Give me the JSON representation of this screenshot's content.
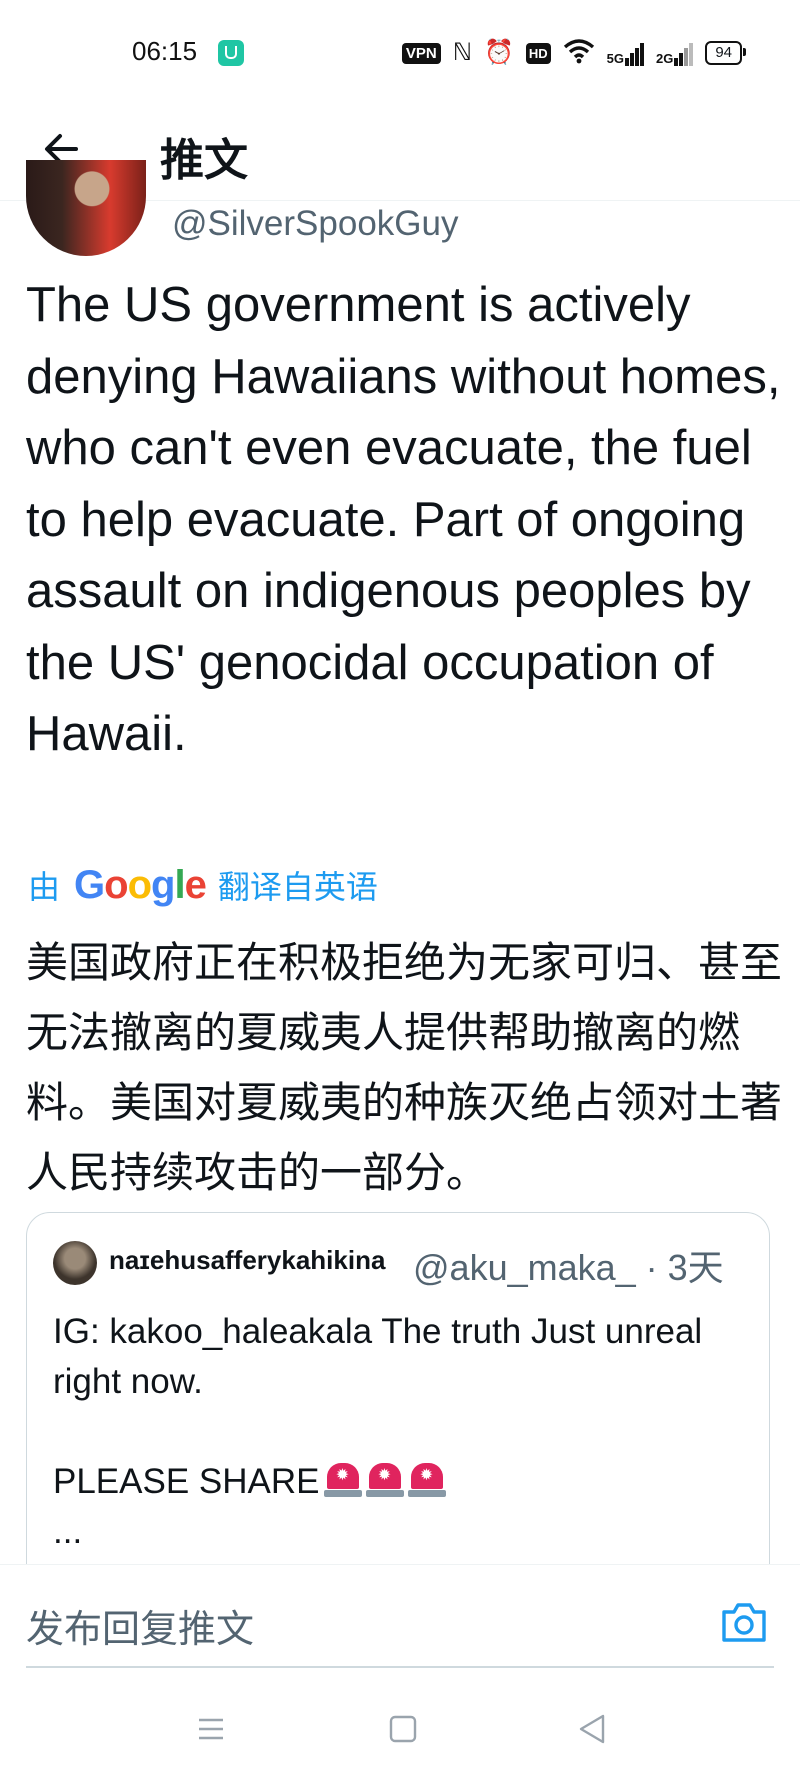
{
  "status_bar": {
    "time": "06:15",
    "vpn_label": "VPN",
    "nfc_icon": "nfc-icon",
    "alarm_icon": "alarm-icon",
    "hd_label": "HD",
    "signal1_label": "5G",
    "signal2_label": "2G",
    "battery": "94"
  },
  "header": {
    "title": "推文",
    "back_icon": "back-arrow-icon"
  },
  "tweet": {
    "handle": "@SilverSpookGuy",
    "text": "The US government is actively denying Hawaiians without homes, who can't even evacuate, the fuel to help evacuate. Part of ongoing assault on indigenous peoples by the US' genocidal occupation of Hawaii.",
    "translate_prefix": "由",
    "translate_brand": "Google",
    "translate_suffix": "翻译自英语",
    "translated_text": "美国政府正在积极拒绝为无家可归、甚至无法撤离的夏威夷人提供帮助撤离的燃料。美国对夏威夷的种族灭绝占领对土著人民持续攻击的一部分。"
  },
  "quote": {
    "name": "naɪehusafferykahikina",
    "meta": "@aku_maka_ · 3天",
    "text": "IG: kakoo_haleakala The truth Just unreal right now.\n\nPLEASE SHARE",
    "emoji": "siren-emoji",
    "ellipsis": "..."
  },
  "reply": {
    "placeholder": "发布回复推文",
    "camera_icon": "camera-icon"
  },
  "colors": {
    "accent": "#1d9bf0",
    "text": "#0f1419",
    "secondary": "#536471",
    "border": "#cfd9de"
  }
}
